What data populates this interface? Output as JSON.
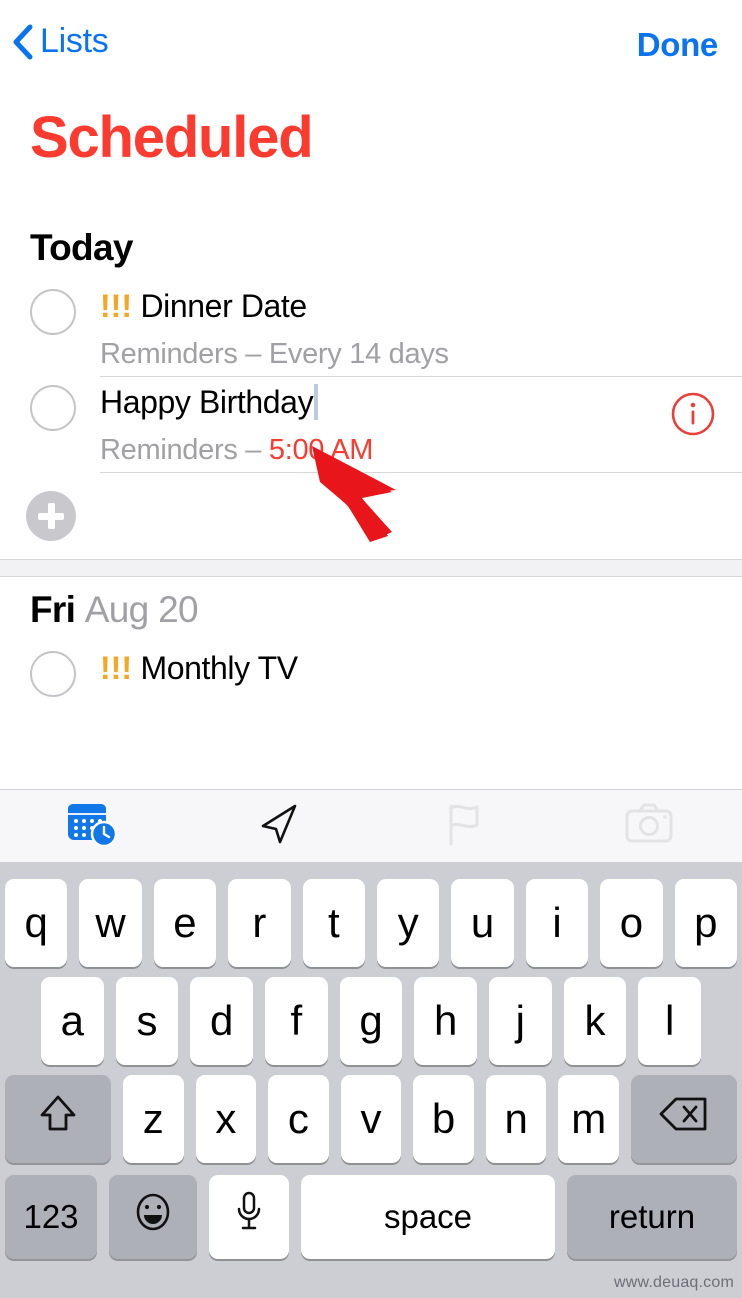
{
  "navbar": {
    "back_label": "Lists",
    "back_icon": "chevron-left-icon",
    "done_label": "Done"
  },
  "page_title": "Scheduled",
  "colors": {
    "accent_red": "#fb3b30",
    "link_blue": "#0a74f0",
    "priority_orange": "#f5a623",
    "muted_gray": "#a0a0a5",
    "keyboard_bg": "#cdced3"
  },
  "sections": [
    {
      "heading_primary": "Today",
      "heading_secondary": "",
      "items": [
        {
          "priority": "!!!",
          "title": "Dinner Date",
          "subtitle_list": "Reminders",
          "subtitle_sep": " – ",
          "subtitle_detail": "Every 14 days",
          "detail_is_red": false,
          "has_info_button": false,
          "is_editing": false
        },
        {
          "priority": "",
          "title": "Happy Birthday",
          "subtitle_list": "Reminders",
          "subtitle_sep": " – ",
          "subtitle_detail": "5:00 AM",
          "detail_is_red": true,
          "has_info_button": true,
          "is_editing": true
        }
      ],
      "add_button_label": "add-reminder"
    },
    {
      "heading_primary": "Fri",
      "heading_secondary": "Aug 20",
      "items": [
        {
          "priority": "!!!",
          "title": "Monthly  TV",
          "subtitle_list": "",
          "subtitle_sep": "",
          "subtitle_detail": "",
          "detail_is_red": false,
          "has_info_button": false,
          "is_editing": false
        }
      ]
    }
  ],
  "annotation": {
    "type": "red-arrow-pointer",
    "color": "#e8161a",
    "points_to": "text-cursor-after-happy-birthday"
  },
  "keyboard": {
    "toolbar": [
      {
        "icon": "calendar-clock-icon",
        "state": "active"
      },
      {
        "icon": "location-arrow-icon",
        "state": "enabled"
      },
      {
        "icon": "flag-icon",
        "state": "disabled"
      },
      {
        "icon": "camera-icon",
        "state": "disabled"
      }
    ],
    "row1": [
      "q",
      "w",
      "e",
      "r",
      "t",
      "y",
      "u",
      "i",
      "o",
      "p"
    ],
    "row2": [
      "a",
      "s",
      "d",
      "f",
      "g",
      "h",
      "j",
      "k",
      "l"
    ],
    "row3": [
      "z",
      "x",
      "c",
      "v",
      "b",
      "n",
      "m"
    ],
    "shift_icon": "shift-arrow-up-icon",
    "backspace_icon": "backspace-delete-icon",
    "numbers_label": "123",
    "emoji_icon": "smiley-emoji-icon",
    "mic_icon": "microphone-icon",
    "space_label": "space",
    "return_label": "return"
  },
  "watermark": "www.deuaq.com"
}
